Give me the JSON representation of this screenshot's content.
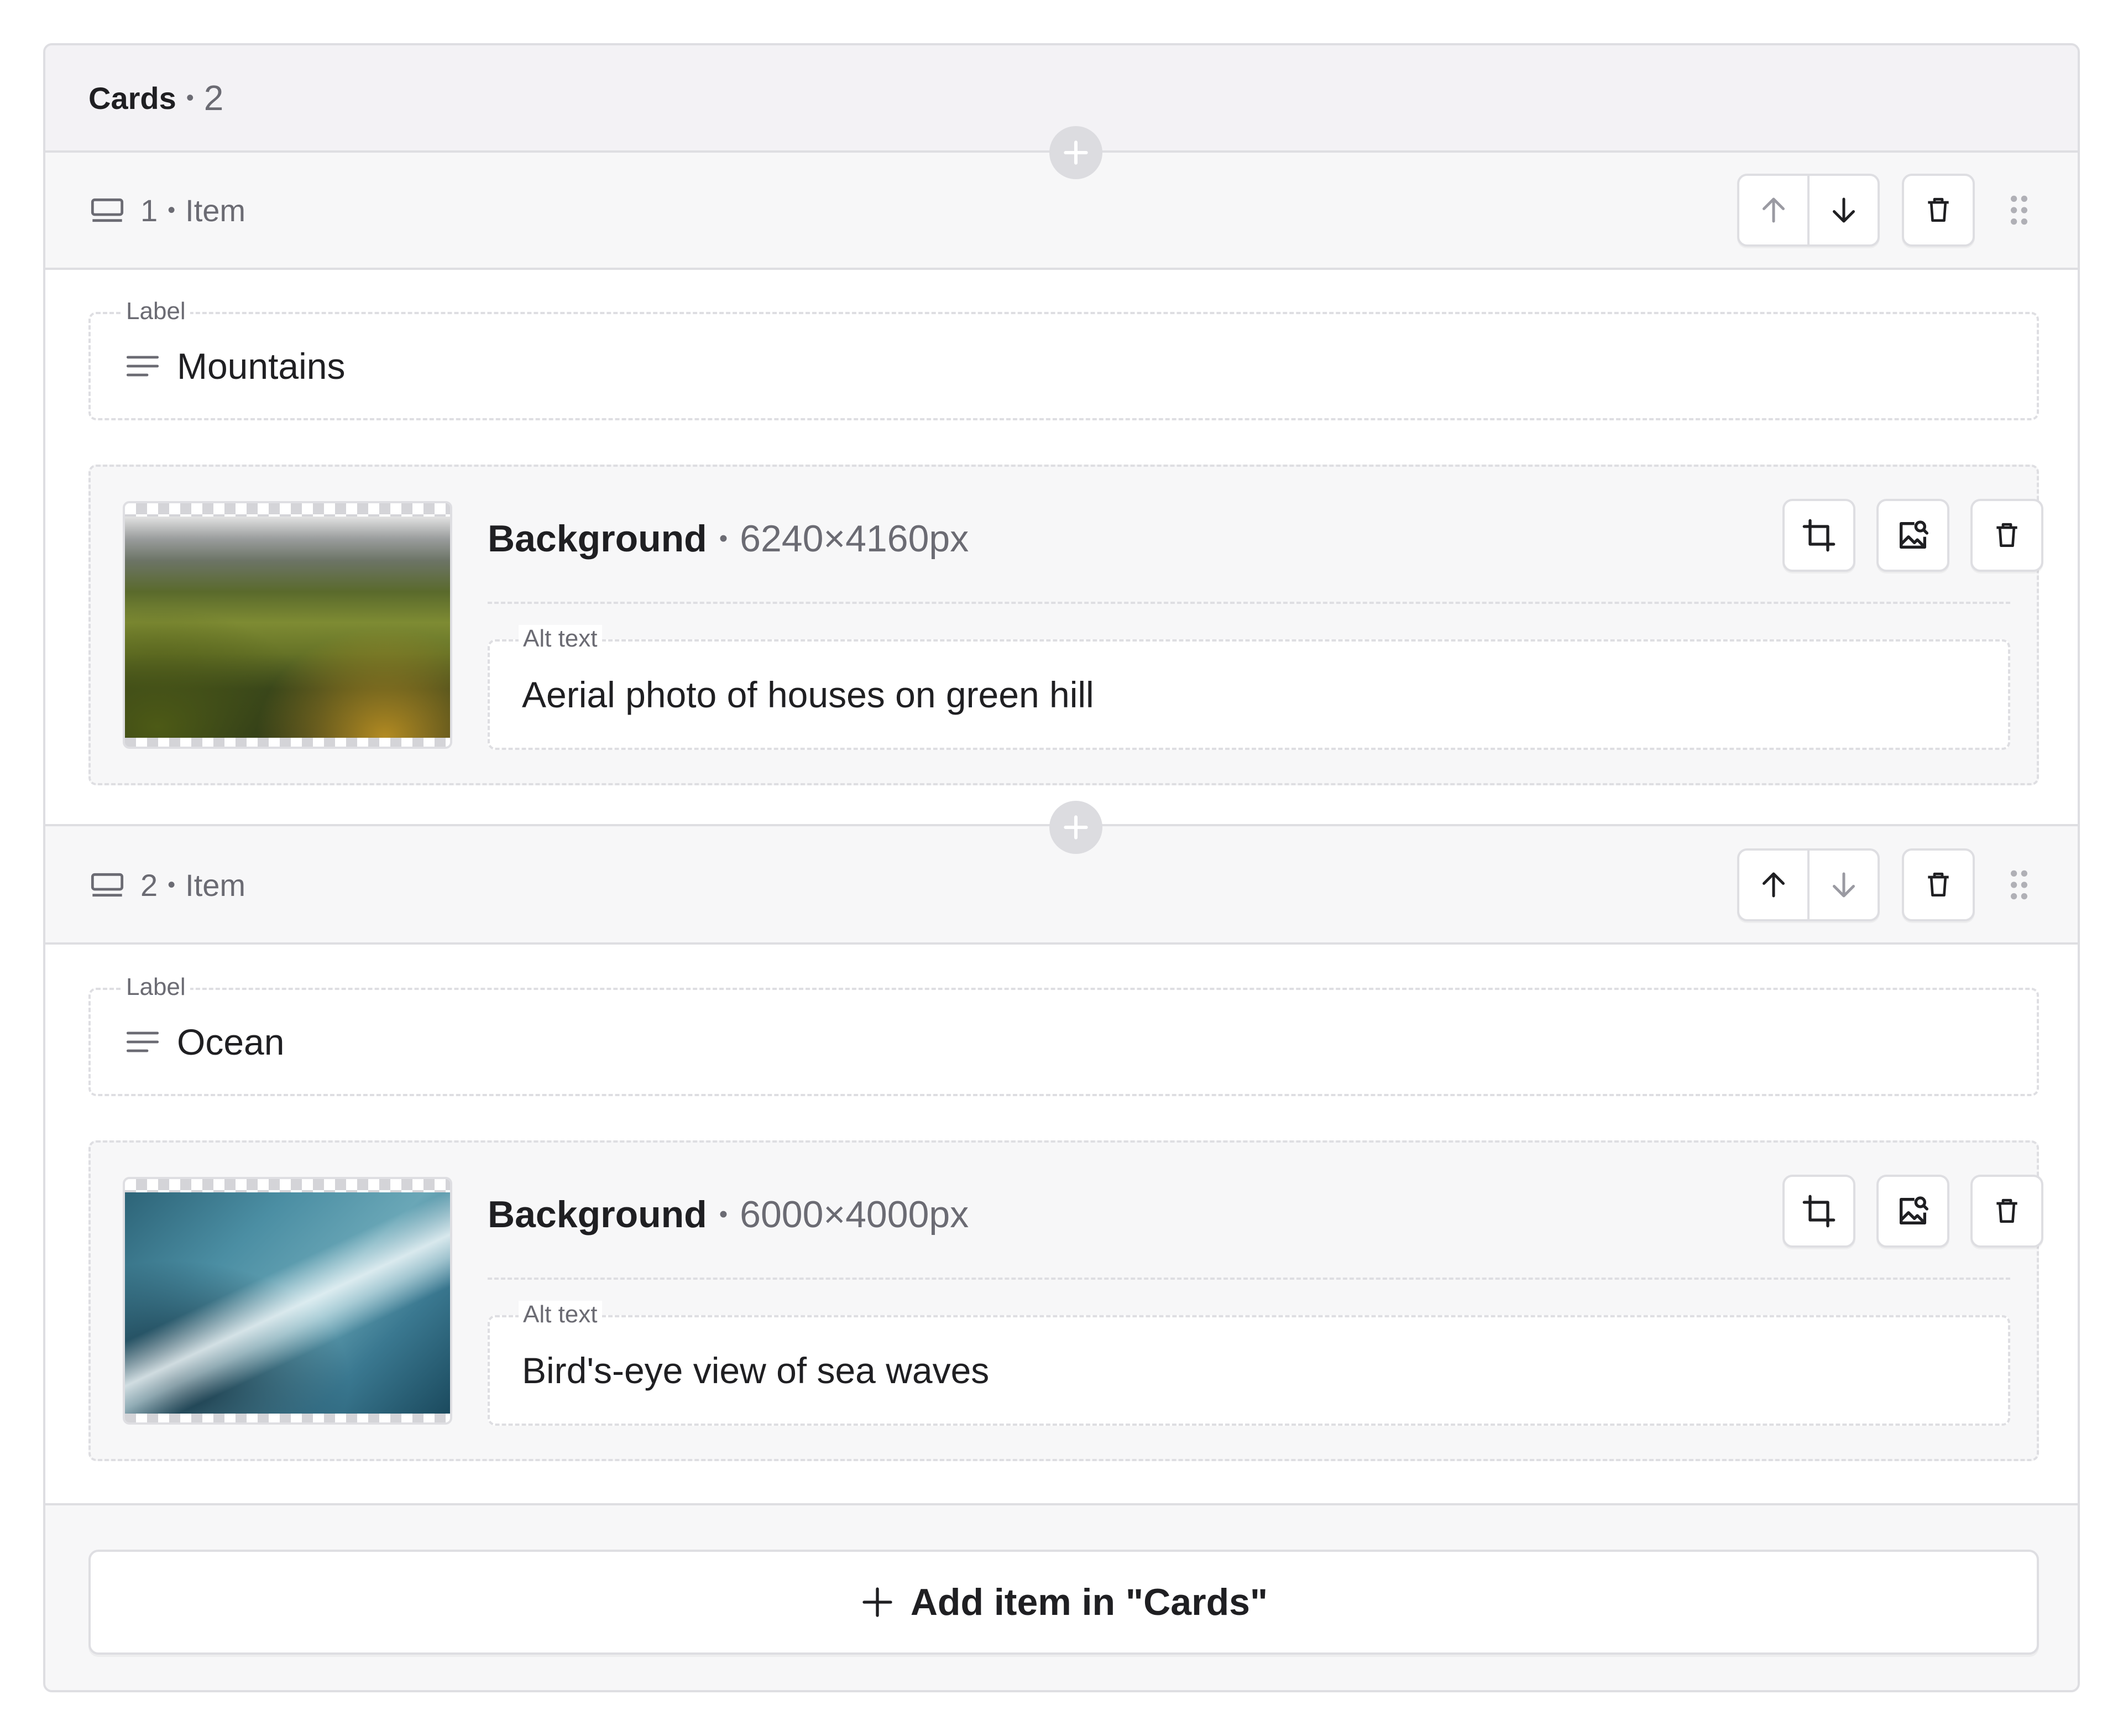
{
  "panel": {
    "title": "Cards",
    "count": "2"
  },
  "items": [
    {
      "index": "1",
      "type_label": "Item",
      "label_field": {
        "label": "Label",
        "value": "Mountains"
      },
      "image": {
        "name": "Background",
        "dimensions": "6240×4160px",
        "alt_label": "Alt text",
        "alt_value": "Aerial photo of houses on green hill"
      },
      "move_up_enabled": false,
      "move_down_enabled": true
    },
    {
      "index": "2",
      "type_label": "Item",
      "label_field": {
        "label": "Label",
        "value": "Ocean"
      },
      "image": {
        "name": "Background",
        "dimensions": "6000×4000px",
        "alt_label": "Alt text",
        "alt_value": "Bird's-eye view of sea waves"
      },
      "move_up_enabled": true,
      "move_down_enabled": false
    }
  ],
  "footer": {
    "add_label": "Add item in \"Cards\""
  },
  "colors": {
    "border": "#dedee2",
    "muted_text": "#6b6b73",
    "text": "#1f1f22",
    "disabled_icon": "#9a9aa2",
    "header_bg": "#f3f2f5"
  },
  "icons": {
    "item": "block-icon",
    "text_field": "lines-icon",
    "move_up": "arrow-up-icon",
    "move_down": "arrow-down-icon",
    "delete": "trash-icon",
    "drag": "drag-handle-icon",
    "crop": "crop-icon",
    "replace_image": "image-search-icon",
    "add": "plus-icon"
  }
}
